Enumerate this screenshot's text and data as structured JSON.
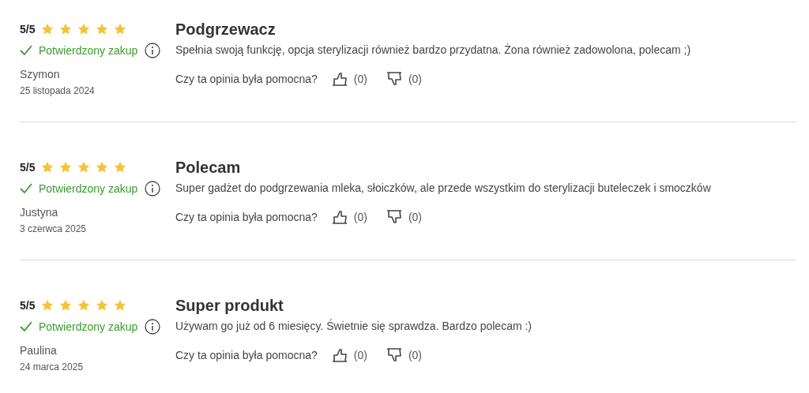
{
  "reviews": [
    {
      "rating": "5/5",
      "stars": 5,
      "verified_label": "Potwierdzony zakup",
      "author": "Szymon",
      "date": "25 listopada 2024",
      "title": "Podgrzewacz",
      "text": "Spełnia swoją funkcję, opcja sterylizacji również bardzo przydatna. Żona również zadowolona, polecam ;)",
      "helpful_question": "Czy ta opinia była pomocna?",
      "likes": "(0)",
      "dislikes": "(0)"
    },
    {
      "rating": "5/5",
      "stars": 5,
      "verified_label": "Potwierdzony zakup",
      "author": "Justyna",
      "date": "3 czerwca 2025",
      "title": "Polecam",
      "text": "Super gadżet do podgrzewania mleka, słoiczków, ale przede wszystkim do sterylizacji buteleczek i smoczków",
      "helpful_question": "Czy ta opinia była pomocna?",
      "likes": "(0)",
      "dislikes": "(0)"
    },
    {
      "rating": "5/5",
      "stars": 5,
      "verified_label": "Potwierdzony zakup",
      "author": "Paulina",
      "date": "24 marca 2025",
      "title": "Super produkt",
      "text": "Używam go już od 6 miesięcy. Świetnie się sprawdza. Bardzo polecam :)",
      "helpful_question": "Czy ta opinia była pomocna?",
      "likes": "(0)",
      "dislikes": "(0)"
    }
  ]
}
